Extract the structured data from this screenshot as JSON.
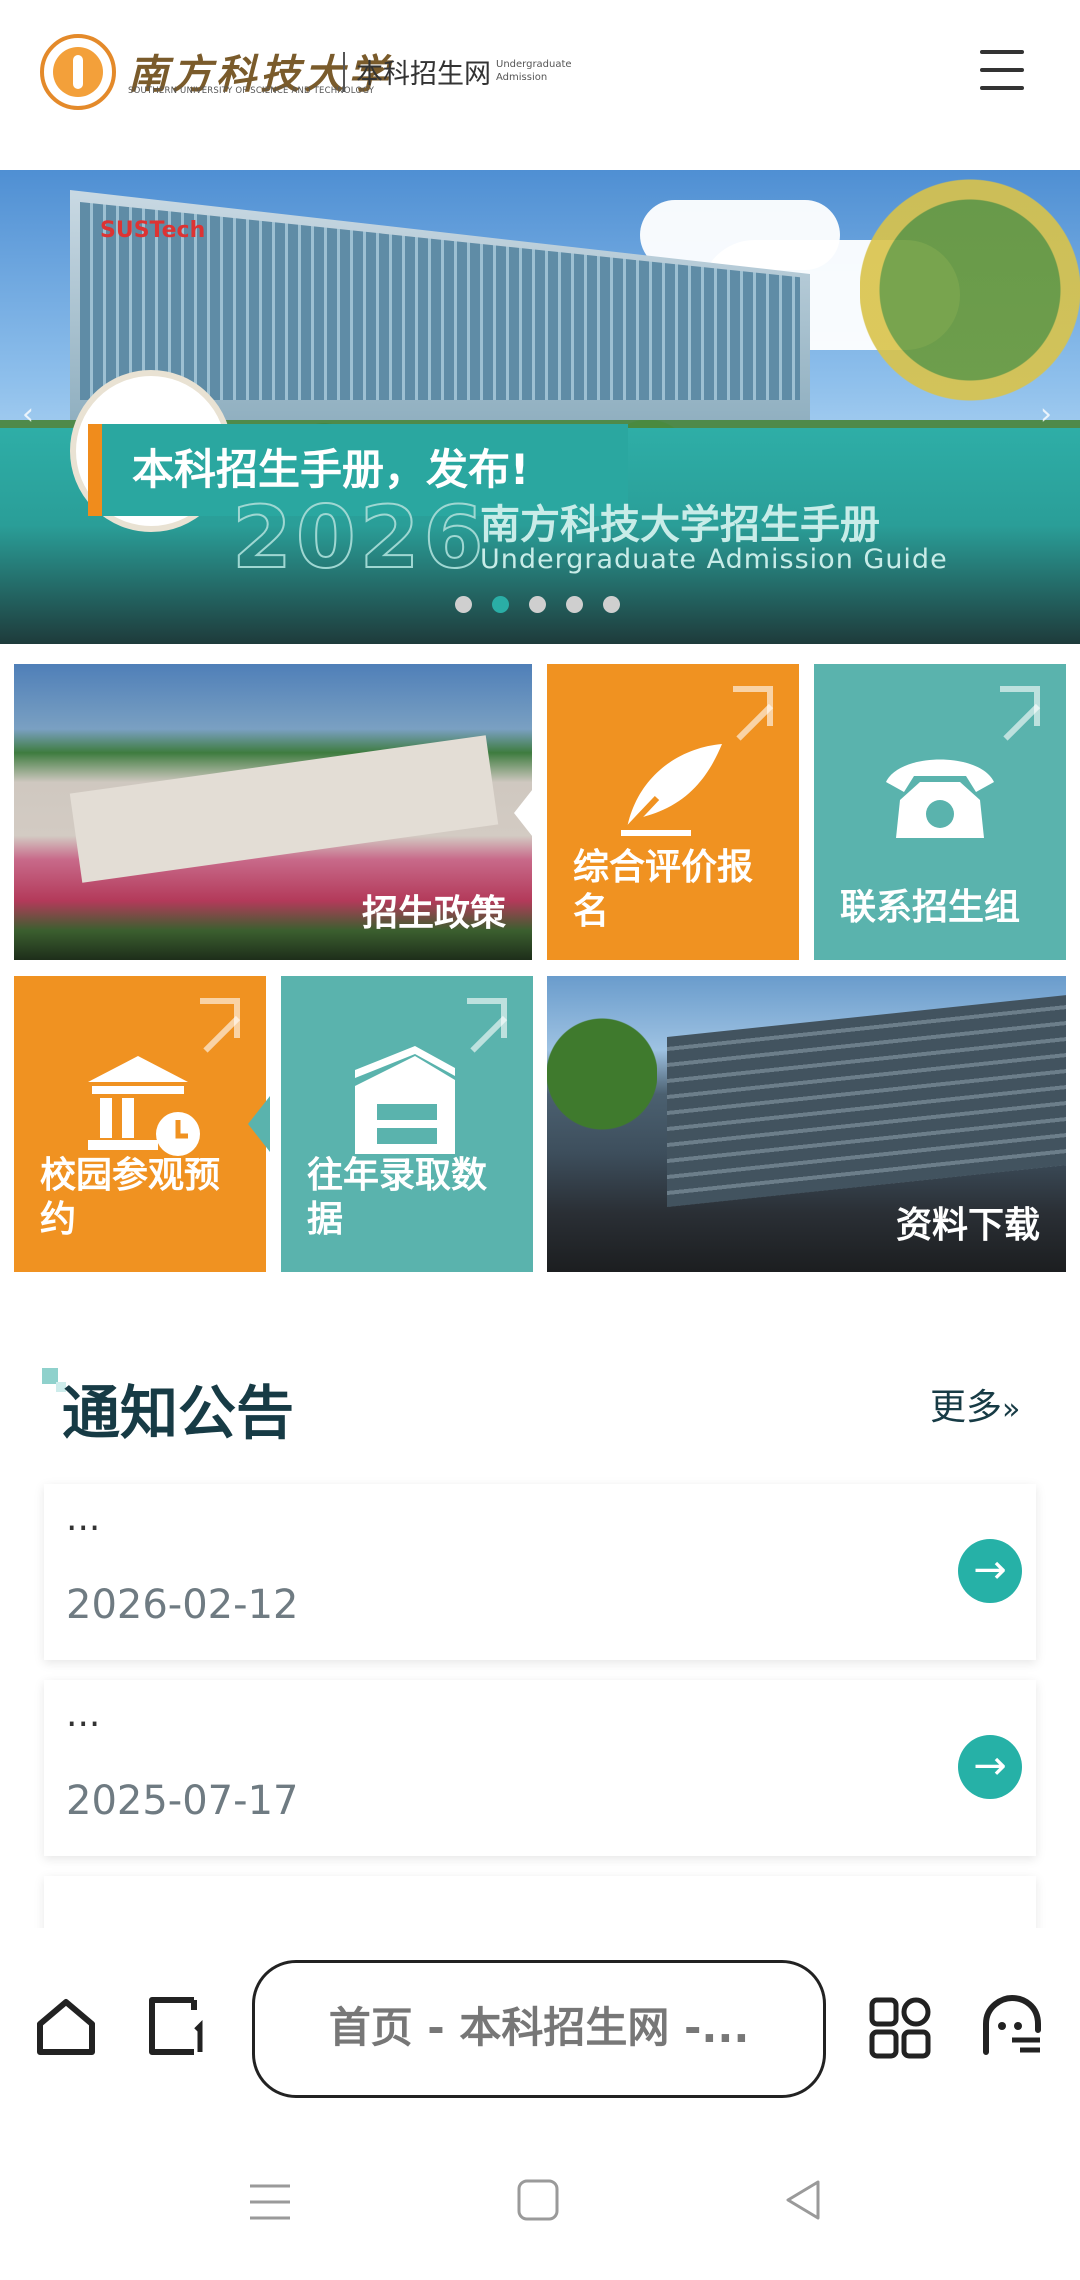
{
  "header": {
    "logo_cn": "南方科技大学",
    "logo_en": "SOUTHERN UNIVERSITY OF SCIENCE AND TECHNOLOGY",
    "site_name": "本科招生网",
    "site_name_en": "Undergraduate Admission",
    "menu_icon": "hamburger-menu-icon"
  },
  "banner": {
    "title": "本科招生手册，发布!",
    "guide_year": "2026",
    "guide_cn": "南方科技大学招生手册",
    "guide_en": "Undergraduate Admission Guide",
    "sign_text": "SUSTech",
    "slide_count": 5,
    "active_slide": 2
  },
  "tiles": {
    "policy": "招生政策",
    "comprehensive": "综合评价报名",
    "contact": "联系招生组",
    "visit": "校园参观预约",
    "past_data": "往年录取数据",
    "download": "资料下载"
  },
  "notices": {
    "heading": "通知公告",
    "more": "更多",
    "more_icon": "double-chevron-right-icon",
    "items": [
      {
        "text": "...",
        "date": "2026-02-12"
      },
      {
        "text": "...",
        "date": "2025-07-17"
      }
    ]
  },
  "browser": {
    "address": "首页 - 本科招生网 -...",
    "icons": [
      "home-icon",
      "tab-icon",
      "apps-icon",
      "profile-icon"
    ]
  },
  "colors": {
    "orange": "#f09221",
    "teal": "#5ab3ad",
    "accent_teal": "#26b1a7",
    "dark_text": "#173b45"
  }
}
